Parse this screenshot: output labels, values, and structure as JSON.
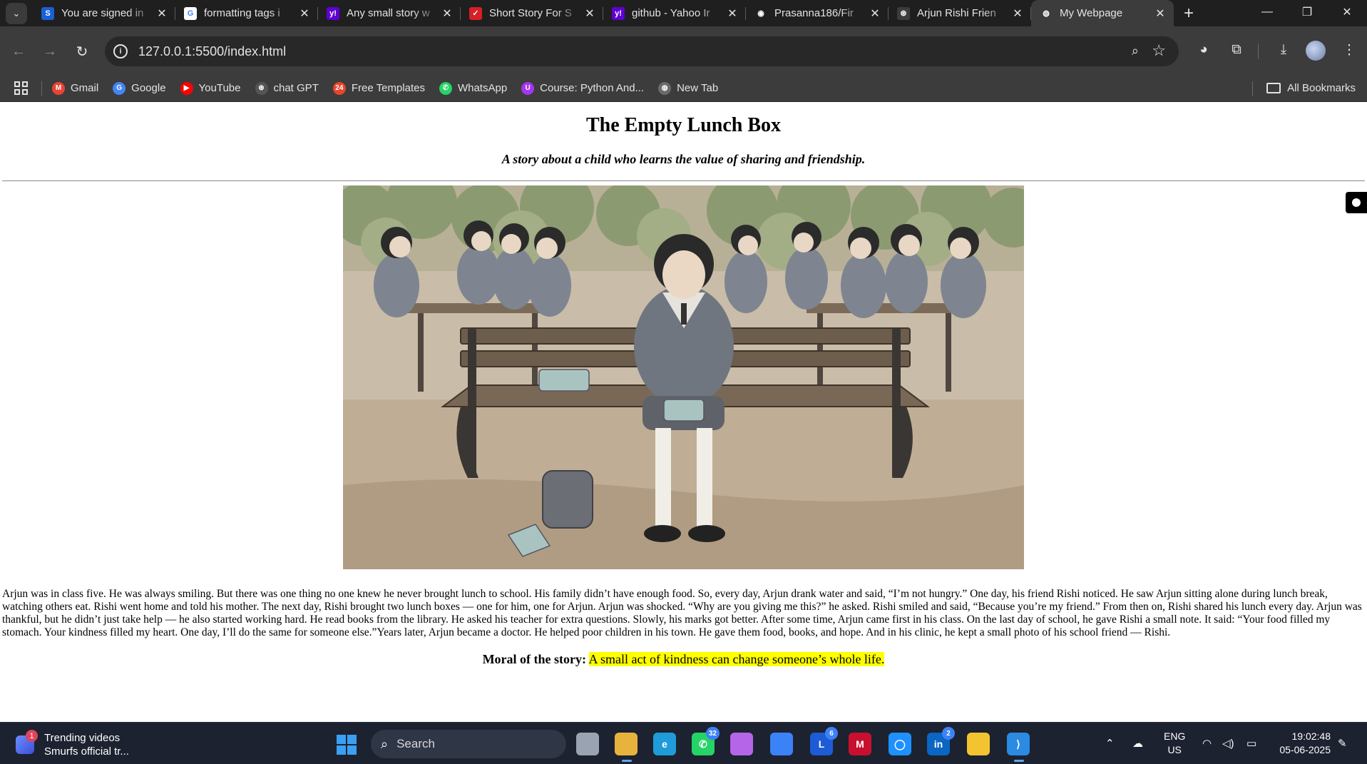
{
  "browser": {
    "tabs": [
      {
        "title": "You are signed in",
        "favicon": "S",
        "favicon_color": "#1a5fd6",
        "fade": true
      },
      {
        "title": "formatting tags i",
        "favicon": "G",
        "favicon_color": "#ffffff",
        "fade": true
      },
      {
        "title": "Any small story w",
        "favicon": "y!",
        "favicon_color": "#6001d2",
        "fade": true
      },
      {
        "title": "Short Story For S",
        "favicon": "✓",
        "favicon_color": "#d61f26",
        "fade": true
      },
      {
        "title": "github - Yahoo Ir",
        "favicon": "y!",
        "favicon_color": "#6001d2",
        "fade": true
      },
      {
        "title": "Prasanna186/Fir",
        "favicon": "◉",
        "favicon_color": "#1f1f1f",
        "fade": true
      },
      {
        "title": "Arjun Rishi Frien",
        "favicon": "⊛",
        "favicon_color": "#3c3c3c",
        "fade": true
      },
      {
        "title": "My Webpage",
        "favicon": "◍",
        "favicon_color": "#3c3c3c",
        "fade": false,
        "active": true
      }
    ],
    "new_tab_icon": "plus-icon",
    "window_controls": {
      "minimize": "—",
      "restore": "❐",
      "close": "✕"
    },
    "address": {
      "url": "127.0.0.1:5500/index.html"
    },
    "bookmarks": [
      {
        "label": "Gmail",
        "icon": "M",
        "color": "#ea4335"
      },
      {
        "label": "Google",
        "icon": "G",
        "color": "#4285f4"
      },
      {
        "label": "YouTube",
        "icon": "▶",
        "color": "#ff0000"
      },
      {
        "label": "chat GPT",
        "icon": "⊛",
        "color": "#555555"
      },
      {
        "label": "Free Templates",
        "icon": "24",
        "color": "#e8452c"
      },
      {
        "label": "WhatsApp",
        "icon": "✆",
        "color": "#25d366"
      },
      {
        "label": "Course: Python And...",
        "icon": "U",
        "color": "#a435f0"
      },
      {
        "label": "New Tab",
        "icon": "◍",
        "color": "#6b6b6b"
      }
    ],
    "all_bookmarks_label": "All Bookmarks"
  },
  "page": {
    "title": "The Empty Lunch Box",
    "subtitle": "A story about a child who learns the value of sharing and friendship.",
    "image_description_name": "story-illustration",
    "story": "Arjun was in class five. He was always smiling. But there was one thing no one knew he never brought lunch to school. His family didn’t have enough food. So, every day, Arjun drank water and said, “I’m not hungry.” One day, his friend Rishi noticed. He saw Arjun sitting alone during lunch break, watching others eat. Rishi went home and told his mother. The next day, Rishi brought two lunch boxes — one for him, one for Arjun. Arjun was shocked. “Why are you giving me this?” he asked. Rishi smiled and said, “Because you’re my friend.” From then on, Rishi shared his lunch every day. Arjun was thankful, but he didn’t just take help — he also started working hard. He read books from the library. He asked his teacher for extra questions. Slowly, his marks got better. After some time, Arjun came first in his class. On the last day of school, he gave Rishi a small note. It said: “Your food filled my stomach. Your kindness filled my heart. One day, I’ll do the same for someone else.”Years later, Arjun became a doctor. He helped poor children in his town. He gave them food, books, and hope. And in his clinic, he kept a small photo of his school friend — Rishi.",
    "moral_label": "Moral of the story:",
    "moral_text": "A small act of kindness can change someone’s whole life."
  },
  "taskbar": {
    "widget_title": "Trending videos",
    "widget_subtitle": "Smurfs official tr...",
    "widget_badge": "1",
    "search_placeholder": "Search",
    "apps": [
      {
        "name": "file-explorer-window",
        "label": "",
        "color": "#9aa3b2"
      },
      {
        "name": "chrome",
        "label": "",
        "color": "#e8b33d",
        "running": true
      },
      {
        "name": "edge",
        "label": "e",
        "color": "#1f9bd9"
      },
      {
        "name": "whatsapp",
        "label": "✆",
        "color": "#25d366",
        "badge": "32"
      },
      {
        "name": "copilot",
        "label": "",
        "color": "#b565e8"
      },
      {
        "name": "store",
        "label": "",
        "color": "#3b82f6"
      },
      {
        "name": "app-l",
        "label": "L",
        "color": "#1e5bd6",
        "badge": "6"
      },
      {
        "name": "mcafee",
        "label": "M",
        "color": "#c8102e"
      },
      {
        "name": "cortana",
        "label": "◯",
        "color": "#1e90ff"
      },
      {
        "name": "linkedin",
        "label": "in",
        "color": "#0a66c2",
        "badge": "2"
      },
      {
        "name": "folder",
        "label": "",
        "color": "#f4c430"
      },
      {
        "name": "vscode",
        "label": "⟩",
        "color": "#2b8ae2",
        "running": true
      }
    ],
    "language": {
      "line1": "ENG",
      "line2": "US"
    },
    "time": "19:02:48",
    "date": "05-06-2025"
  }
}
